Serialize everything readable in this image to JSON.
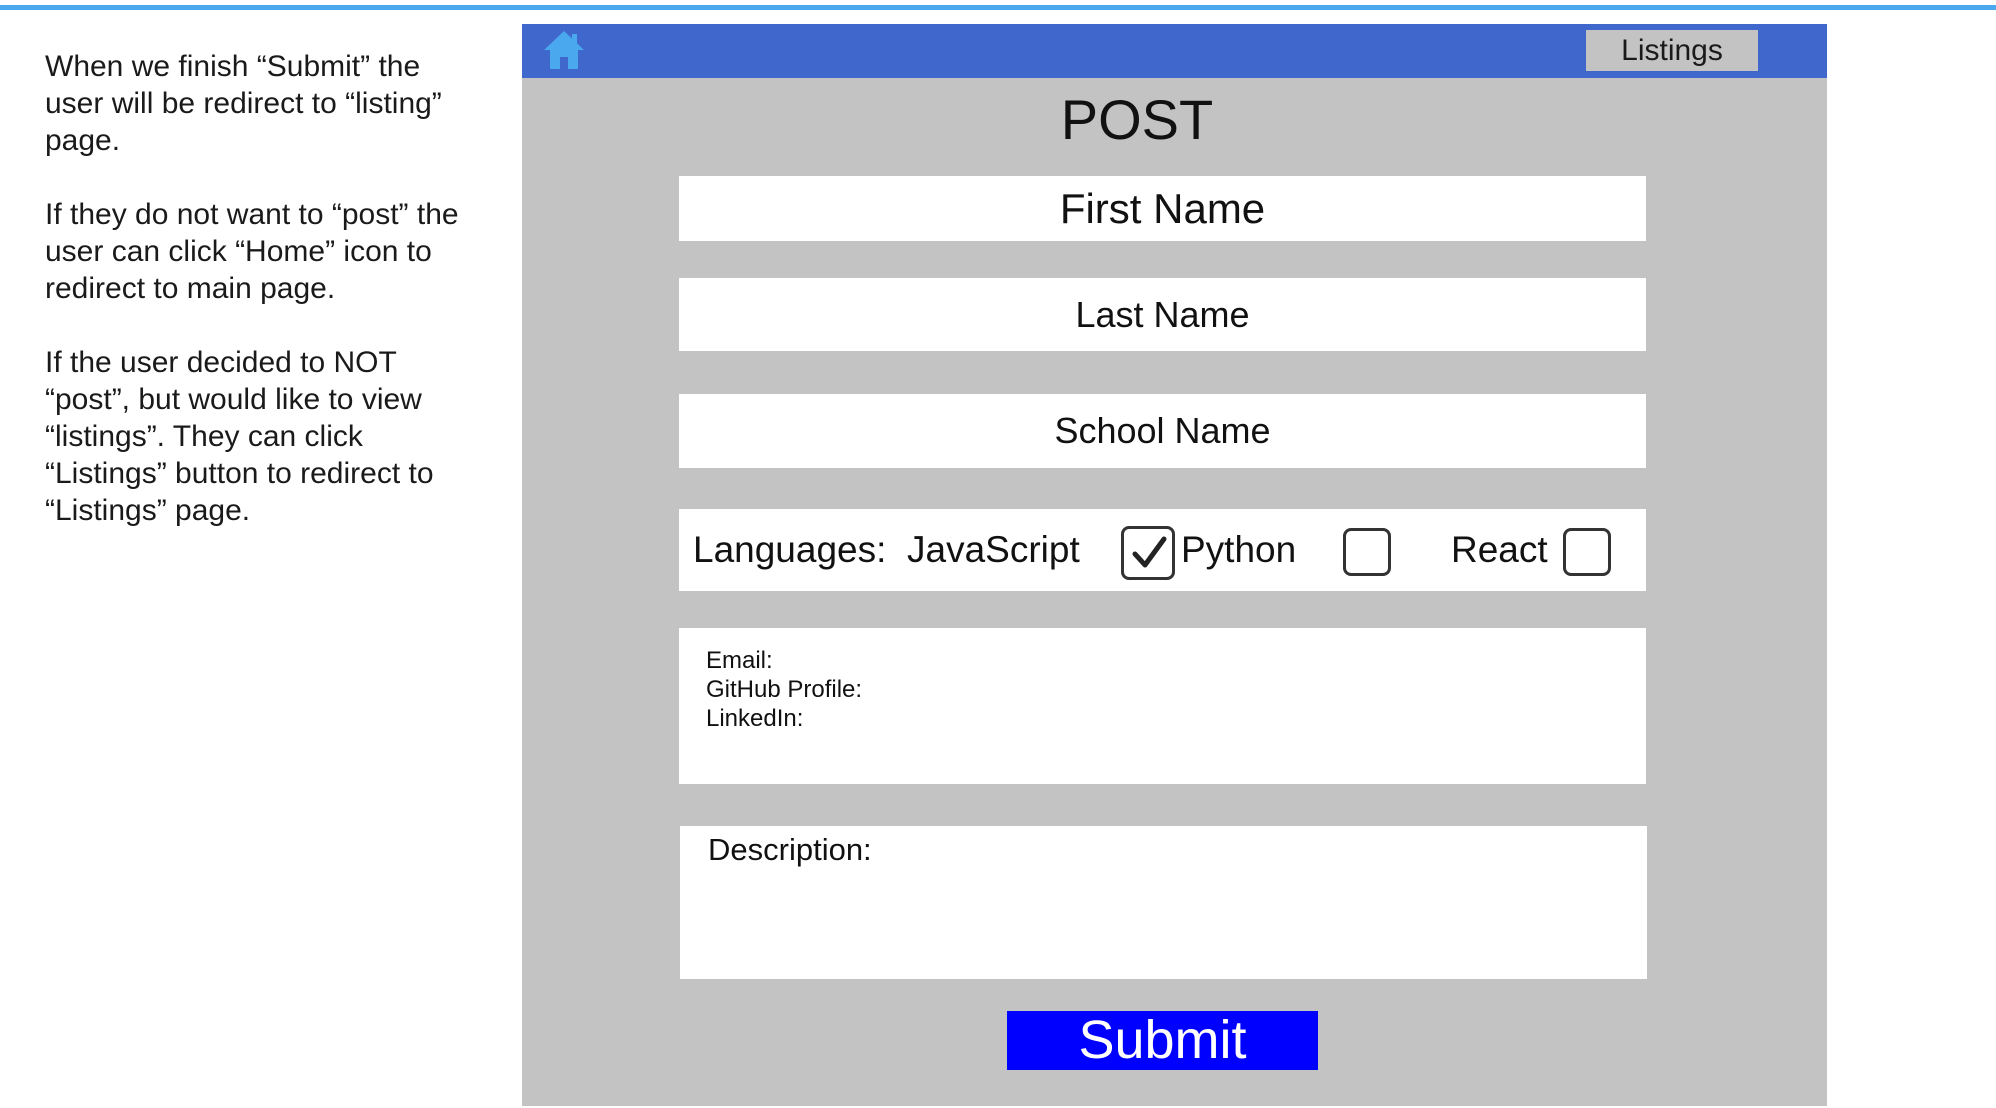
{
  "notes": {
    "paragraphs": [
      "When we finish “Submit” the user will be redirect to “listing” page.",
      "If they do not want to “post” the user can click “Home” icon to redirect to main page.",
      "If the user decided to NOT “post”, but would like to view “listings”. They can click “Listings” button to redirect to “Listings” page."
    ]
  },
  "navbar": {
    "home_icon": "home-icon",
    "listings_label": "Listings",
    "color": "#3f67cc",
    "icon_color": "#4aa8ee"
  },
  "form": {
    "title": "POST",
    "first_name_placeholder": "First Name",
    "last_name_placeholder": "Last Name",
    "school_name_placeholder": "School Name",
    "languages": {
      "label": "Languages:",
      "options": [
        {
          "label": "JavaScript",
          "checked": true
        },
        {
          "label": "Python",
          "checked": false
        },
        {
          "label": "React",
          "checked": false
        }
      ]
    },
    "contact": {
      "email_label": "Email:",
      "github_label": "GitHub Profile:",
      "linkedin_label": "LinkedIn:"
    },
    "description_label": "Description:",
    "submit_label": "Submit",
    "submit_color": "#0000ff",
    "background_color": "#c3c3c3"
  }
}
